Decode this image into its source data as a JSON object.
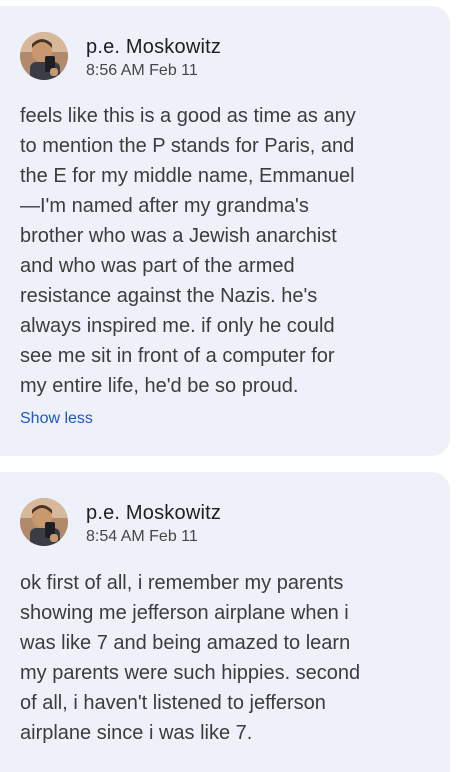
{
  "comments": [
    {
      "author": "p.e. Moskowitz",
      "time": "8:56 AM Feb 11",
      "text": "feels like this is a good as time as any\nto mention the P stands for Paris, and\nthe E for my middle name, Emmanuel\n—I'm named after my grandma's\nbrother who was a Jewish anarchist\nand who was part of the armed\nresistance against the Nazis. he's\nalways inspired me. if only he could\nsee me sit in front of a computer for\nmy entire life, he'd be so proud.",
      "toggle_label": "Show less"
    },
    {
      "author": "p.e. Moskowitz",
      "time": "8:54 AM Feb 11",
      "text": "ok first of all, i remember my parents\nshowing me jefferson airplane when i\nwas like 7 and being amazed to learn\nmy parents were such hippies. second\nof all, i haven't listened to jefferson\nairplane since i was like 7."
    }
  ],
  "colors": {
    "card_background": "#eef1f9",
    "link": "#1a57c9",
    "text": "#3c3c3c"
  }
}
